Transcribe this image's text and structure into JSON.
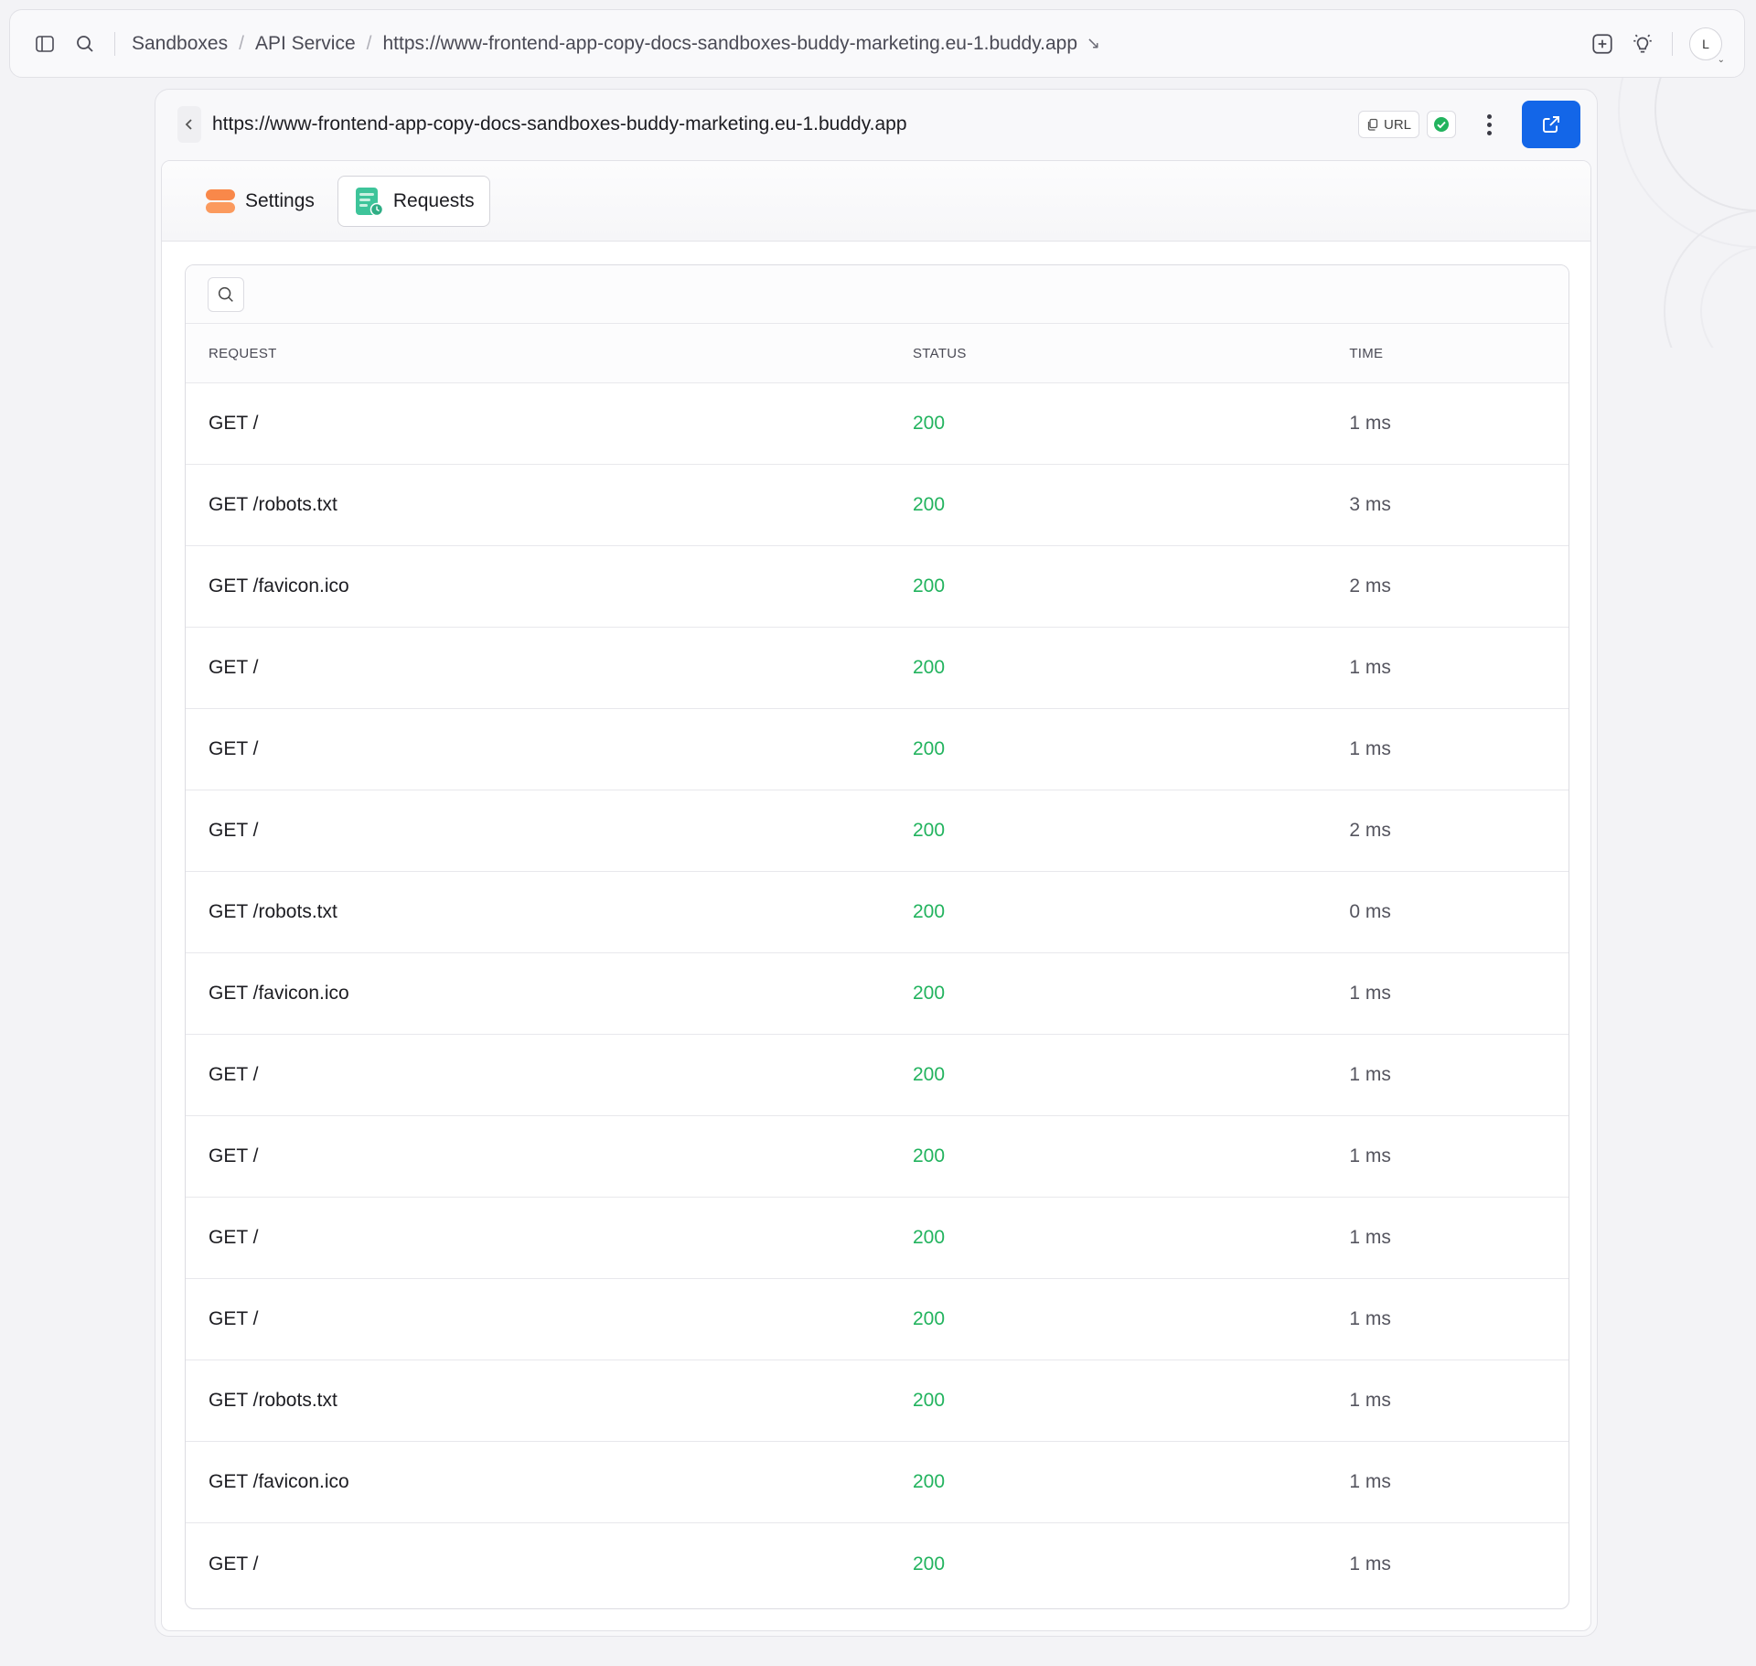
{
  "breadcrumbs": [
    "Sandboxes",
    "API Service",
    "https://www-frontend-app-copy-docs-sandboxes-buddy-marketing.eu-1.buddy.app"
  ],
  "user": {
    "initial": "L"
  },
  "panel": {
    "url": "https://www-frontend-app-copy-docs-sandboxes-buddy-marketing.eu-1.buddy.app",
    "copy_label": "URL",
    "status": "ok",
    "accent": "#1366e8"
  },
  "tabs": [
    {
      "label": "Settings",
      "icon": "settings-server-icon",
      "active": false
    },
    {
      "label": "Requests",
      "icon": "requests-log-icon",
      "active": true
    }
  ],
  "table": {
    "headers": [
      "REQUEST",
      "STATUS",
      "TIME"
    ],
    "rows": [
      {
        "request": "GET /",
        "status": "200",
        "time": "1 ms"
      },
      {
        "request": "GET /robots.txt",
        "status": "200",
        "time": "3 ms"
      },
      {
        "request": "GET /favicon.ico",
        "status": "200",
        "time": "2 ms"
      },
      {
        "request": "GET /",
        "status": "200",
        "time": "1 ms"
      },
      {
        "request": "GET /",
        "status": "200",
        "time": "1 ms"
      },
      {
        "request": "GET /",
        "status": "200",
        "time": "2 ms"
      },
      {
        "request": "GET /robots.txt",
        "status": "200",
        "time": "0 ms"
      },
      {
        "request": "GET /favicon.ico",
        "status": "200",
        "time": "1 ms"
      },
      {
        "request": "GET /",
        "status": "200",
        "time": "1 ms"
      },
      {
        "request": "GET /",
        "status": "200",
        "time": "1 ms"
      },
      {
        "request": "GET /",
        "status": "200",
        "time": "1 ms"
      },
      {
        "request": "GET /",
        "status": "200",
        "time": "1 ms"
      },
      {
        "request": "GET /robots.txt",
        "status": "200",
        "time": "1 ms"
      },
      {
        "request": "GET /favicon.ico",
        "status": "200",
        "time": "1 ms"
      },
      {
        "request": "GET /",
        "status": "200",
        "time": "1 ms"
      }
    ]
  },
  "colors": {
    "success": "#22b35e",
    "settings_icon": "#f9884a",
    "requests_icon": "#3ec49a"
  }
}
